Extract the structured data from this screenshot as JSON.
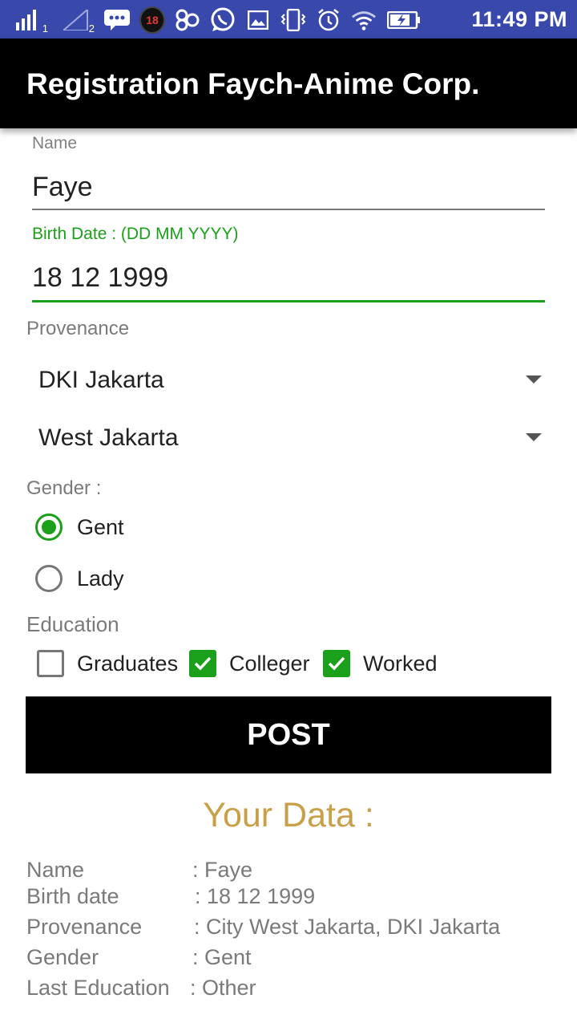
{
  "status_bar": {
    "sim1_label": "1",
    "sim2_label": "2",
    "notification_count": "18",
    "time": "11:49 PM",
    "icons": [
      "signal-icon",
      "signal-weak-icon",
      "message-icon",
      "notification-badge-icon",
      "app-icon",
      "whatsapp-icon",
      "image-icon",
      "vibrate-icon",
      "alarm-icon",
      "wifi-icon",
      "battery-icon"
    ]
  },
  "app_bar": {
    "title": "Registration Faych-Anime Corp."
  },
  "form": {
    "name": {
      "label": "Name",
      "value": "Faye"
    },
    "birth_date": {
      "label": "Birth Date : (DD MM YYYY)",
      "value": "18 12 1999"
    },
    "provenance": {
      "label": "Provenance",
      "province": "DKI Jakarta",
      "city": "West Jakarta"
    },
    "gender": {
      "label": "Gender :",
      "options": [
        {
          "label": "Gent",
          "checked": true
        },
        {
          "label": "Lady",
          "checked": false
        }
      ]
    },
    "education": {
      "label": "Education",
      "options": [
        {
          "label": "Graduates",
          "checked": false
        },
        {
          "label": "Colleger",
          "checked": true
        },
        {
          "label": "Worked",
          "checked": true
        }
      ]
    },
    "post_button": "POST"
  },
  "result": {
    "title": "Your Data :",
    "rows": [
      {
        "label": "Name",
        "value": ": Faye"
      },
      {
        "label": "Birth date",
        "value": ": 18 12 1999"
      },
      {
        "label": "Provenance",
        "value": ": City West Jakarta, DKI Jakarta"
      },
      {
        "label": "Gender",
        "value": ": Gent"
      },
      {
        "label": "Last Education",
        "value": ": Other"
      }
    ]
  },
  "colors": {
    "status_bar": "#3949ab",
    "app_bar": "#000000",
    "accent": "#1aa01a",
    "result_title": "#c9a04a"
  }
}
